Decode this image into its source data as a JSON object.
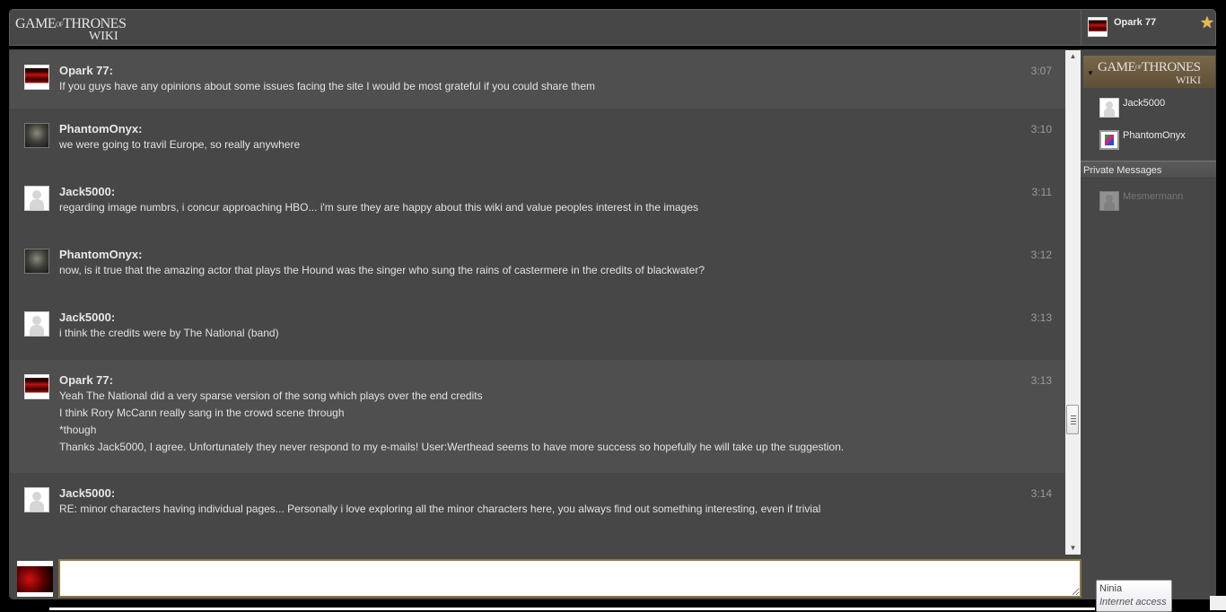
{
  "header": {
    "logo_line1": "GAME",
    "logo_of": "OF",
    "logo_line1b": "THRONES",
    "logo_line2": "WIKI",
    "current_user": "Opark 77",
    "star_icon": "★"
  },
  "messages": [
    {
      "user": "Opark 77:",
      "time": "3:07",
      "avatar": "opark",
      "lines": [
        "If you guys have any opinions about some issues facing the site I would be most grateful if you could share them"
      ]
    },
    {
      "user": "PhantomOnyx:",
      "time": "3:10",
      "avatar": "phantom",
      "lines": [
        "we were going to travil Europe, so really anywhere"
      ]
    },
    {
      "user": "Jack5000:",
      "time": "3:11",
      "avatar": "default",
      "lines": [
        "regarding image numbrs, i concur approaching HBO... i'm sure they are happy about this wiki and value peoples interest in the images"
      ]
    },
    {
      "user": "PhantomOnyx:",
      "time": "3:12",
      "avatar": "phantom",
      "lines": [
        "now, is it true that the amazing actor that plays the Hound was the singer who sung the rains of castermere in the credits of blackwater?"
      ]
    },
    {
      "user": "Jack5000:",
      "time": "3:13",
      "avatar": "default",
      "lines": [
        "i think the credits were by The National (band)"
      ]
    },
    {
      "user": "Opark 77:",
      "time": "3:13",
      "avatar": "opark",
      "lines": [
        "Yeah The National did a very sparse version of the song which plays over the end credits",
        "I think Rory McCann really sang in the crowd scene through",
        "*though",
        "Thanks Jack5000, I agree. Unfortunately they never respond to my e-mails! User:Werthead seems to have more success so hopefully he will take up the suggestion."
      ]
    },
    {
      "user": "Jack5000:",
      "time": "3:14",
      "avatar": "default",
      "lines": [
        "RE: minor characters having individual pages... Personally i love exploring all the minor characters here, you always find out something interesting, even if trivial"
      ]
    }
  ],
  "sidebar": {
    "room_logo_line1": "GAME",
    "room_logo_of": "OF",
    "room_logo_line1b": "THRONES",
    "room_logo_line2": "WIKI",
    "users": [
      {
        "name": "Jack5000",
        "avatar": "default"
      },
      {
        "name": "PhantomOnyx",
        "avatar": "broken"
      }
    ],
    "private_messages_label": "Private Messages",
    "private_users": [
      {
        "name": "Mesmermann",
        "avatar": "default"
      }
    ]
  },
  "input": {
    "value": "",
    "placeholder": ""
  },
  "tooltip": {
    "title": "Ninia",
    "subtitle": "Internet access"
  },
  "scrollbar": {
    "position_fraction": 0.76
  }
}
